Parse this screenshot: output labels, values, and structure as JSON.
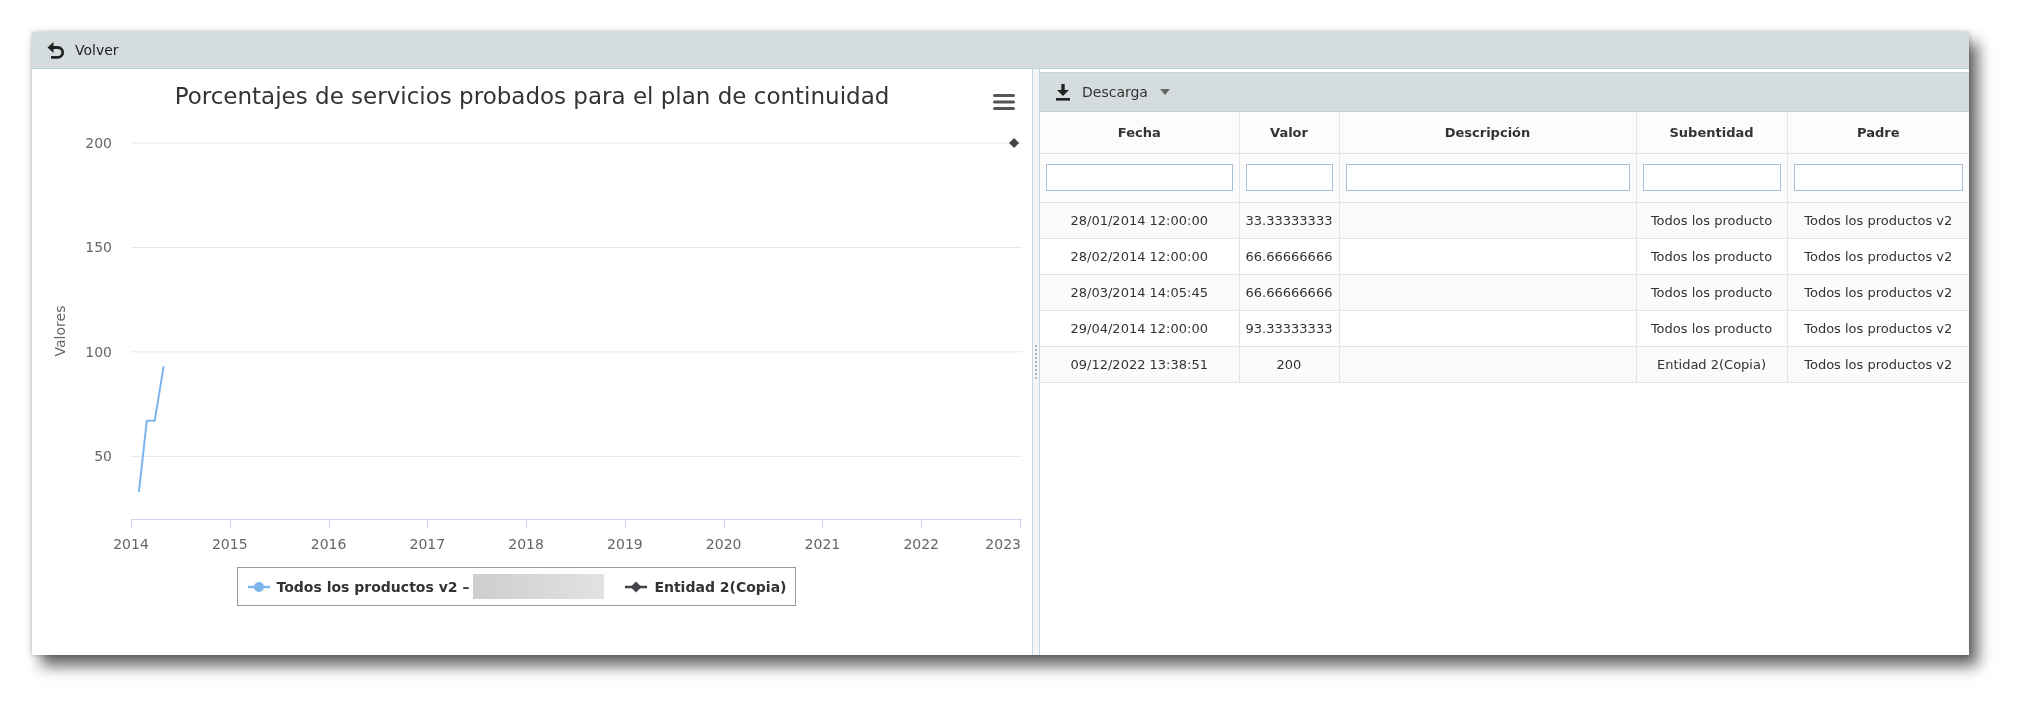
{
  "toolbar": {
    "back_button": "Volver"
  },
  "chart_panel": {
    "chart_data": {
      "type": "line",
      "title": "Porcentajes de servicios probados para el plan de continuidad",
      "ylabel": "Valores",
      "grid": true,
      "legend": "bottom",
      "x": [
        2014.08,
        2014.16,
        2014.24,
        2014.33,
        2022.94
      ],
      "series": [
        {
          "name": "Todos los productos v2 –",
          "color": "#7cb5ec",
          "marker": "none",
          "values": [
            33,
            67,
            67,
            93,
            null
          ]
        },
        {
          "name": "Entidad 2(Copia)",
          "color": "#434348",
          "marker": "diamond",
          "values": [
            null,
            null,
            null,
            null,
            200
          ]
        }
      ],
      "xlim": [
        2014,
        2023
      ],
      "ylim": [
        20,
        200
      ],
      "xticks": [
        2014,
        2015,
        2016,
        2017,
        2018,
        2019,
        2020,
        2021,
        2022,
        2023
      ],
      "yticks": [
        50,
        100,
        150,
        200
      ]
    }
  },
  "table_panel": {
    "download_button": "Descarga",
    "columns": [
      "Fecha",
      "Valor",
      "Descripción",
      "Subentidad",
      "Padre"
    ],
    "rows": [
      [
        "28/01/2014 12:00:00",
        "33.33333333",
        null,
        "Todos los producto",
        "Todos los productos v2"
      ],
      [
        "28/02/2014 12:00:00",
        "66.66666666",
        null,
        "Todos los producto",
        "Todos los productos v2"
      ],
      [
        "28/03/2014 14:05:45",
        "66.66666666",
        null,
        "Todos los producto",
        "Todos los productos v2"
      ],
      [
        "29/04/2014 12:00:00",
        "93.33333333",
        null,
        "Todos los producto",
        "Todos los productos v2"
      ],
      [
        "09/12/2022 13:38:51",
        "200",
        null,
        "Entidad 2(Copia)",
        "Todos los productos v2"
      ]
    ]
  }
}
